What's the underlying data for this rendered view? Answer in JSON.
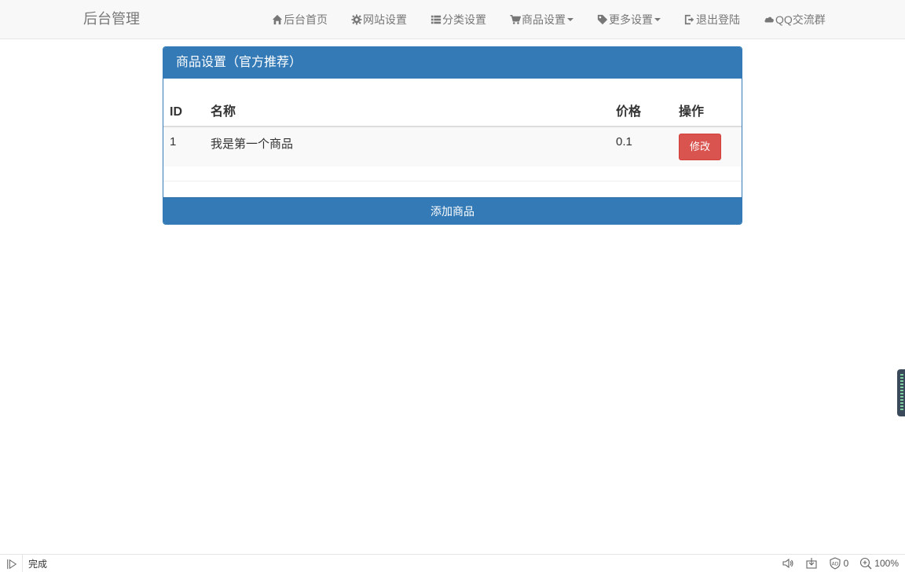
{
  "navbar": {
    "brand": "后台管理",
    "items": [
      {
        "label": "后台首页",
        "icon": "home-icon"
      },
      {
        "label": "网站设置",
        "icon": "gear-icon"
      },
      {
        "label": "分类设置",
        "icon": "list-icon"
      },
      {
        "label": "商品设置",
        "icon": "cart-icon",
        "dropdown": true
      },
      {
        "label": "更多设置",
        "icon": "tag-icon",
        "dropdown": true
      },
      {
        "label": "退出登陆",
        "icon": "logout-icon"
      },
      {
        "label": "QQ交流群",
        "icon": "cloud-icon"
      }
    ]
  },
  "panel": {
    "title": "商品设置（官方推荐）",
    "columns": [
      "ID",
      "名称",
      "价格",
      "操作"
    ],
    "rows": [
      {
        "id": "1",
        "name": "我是第一个商品",
        "price": "0.1",
        "action": "修改"
      }
    ],
    "add_button": "添加商品"
  },
  "statusbar": {
    "status": "完成",
    "blocked_count": "0",
    "zoom": "100%"
  },
  "colors": {
    "primary": "#337ab7",
    "danger": "#d9534f",
    "navbar_bg": "#f8f8f8",
    "nav_text": "#777777"
  }
}
